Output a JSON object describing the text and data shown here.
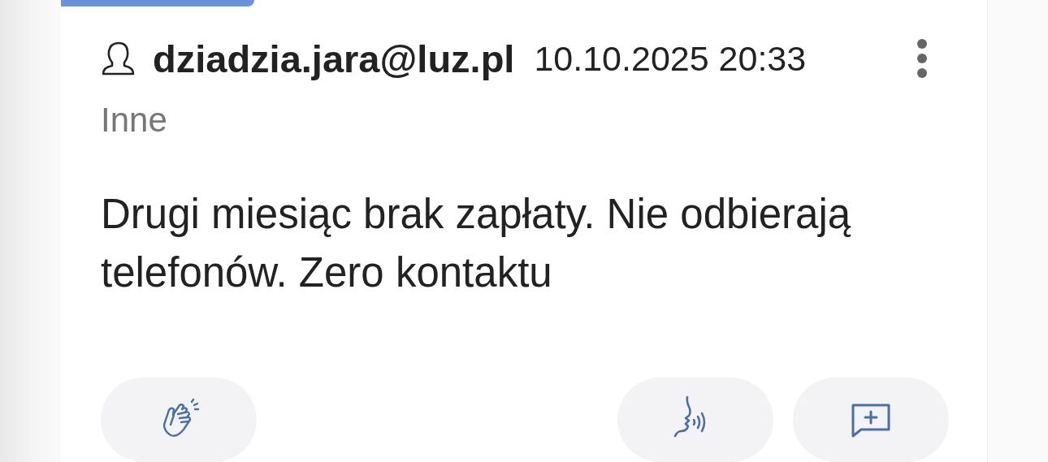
{
  "post": {
    "author": "dziadzia.jara@luz.pl",
    "date": "10.10.2025 20:33",
    "category": "Inne",
    "body": "Drugi miesiąc brak zapłaty. Nie odbierają telefonów. Zero kontaktu",
    "actions": [
      {
        "kind": "applause"
      },
      {
        "kind": "speak"
      },
      {
        "kind": "comment"
      }
    ]
  }
}
